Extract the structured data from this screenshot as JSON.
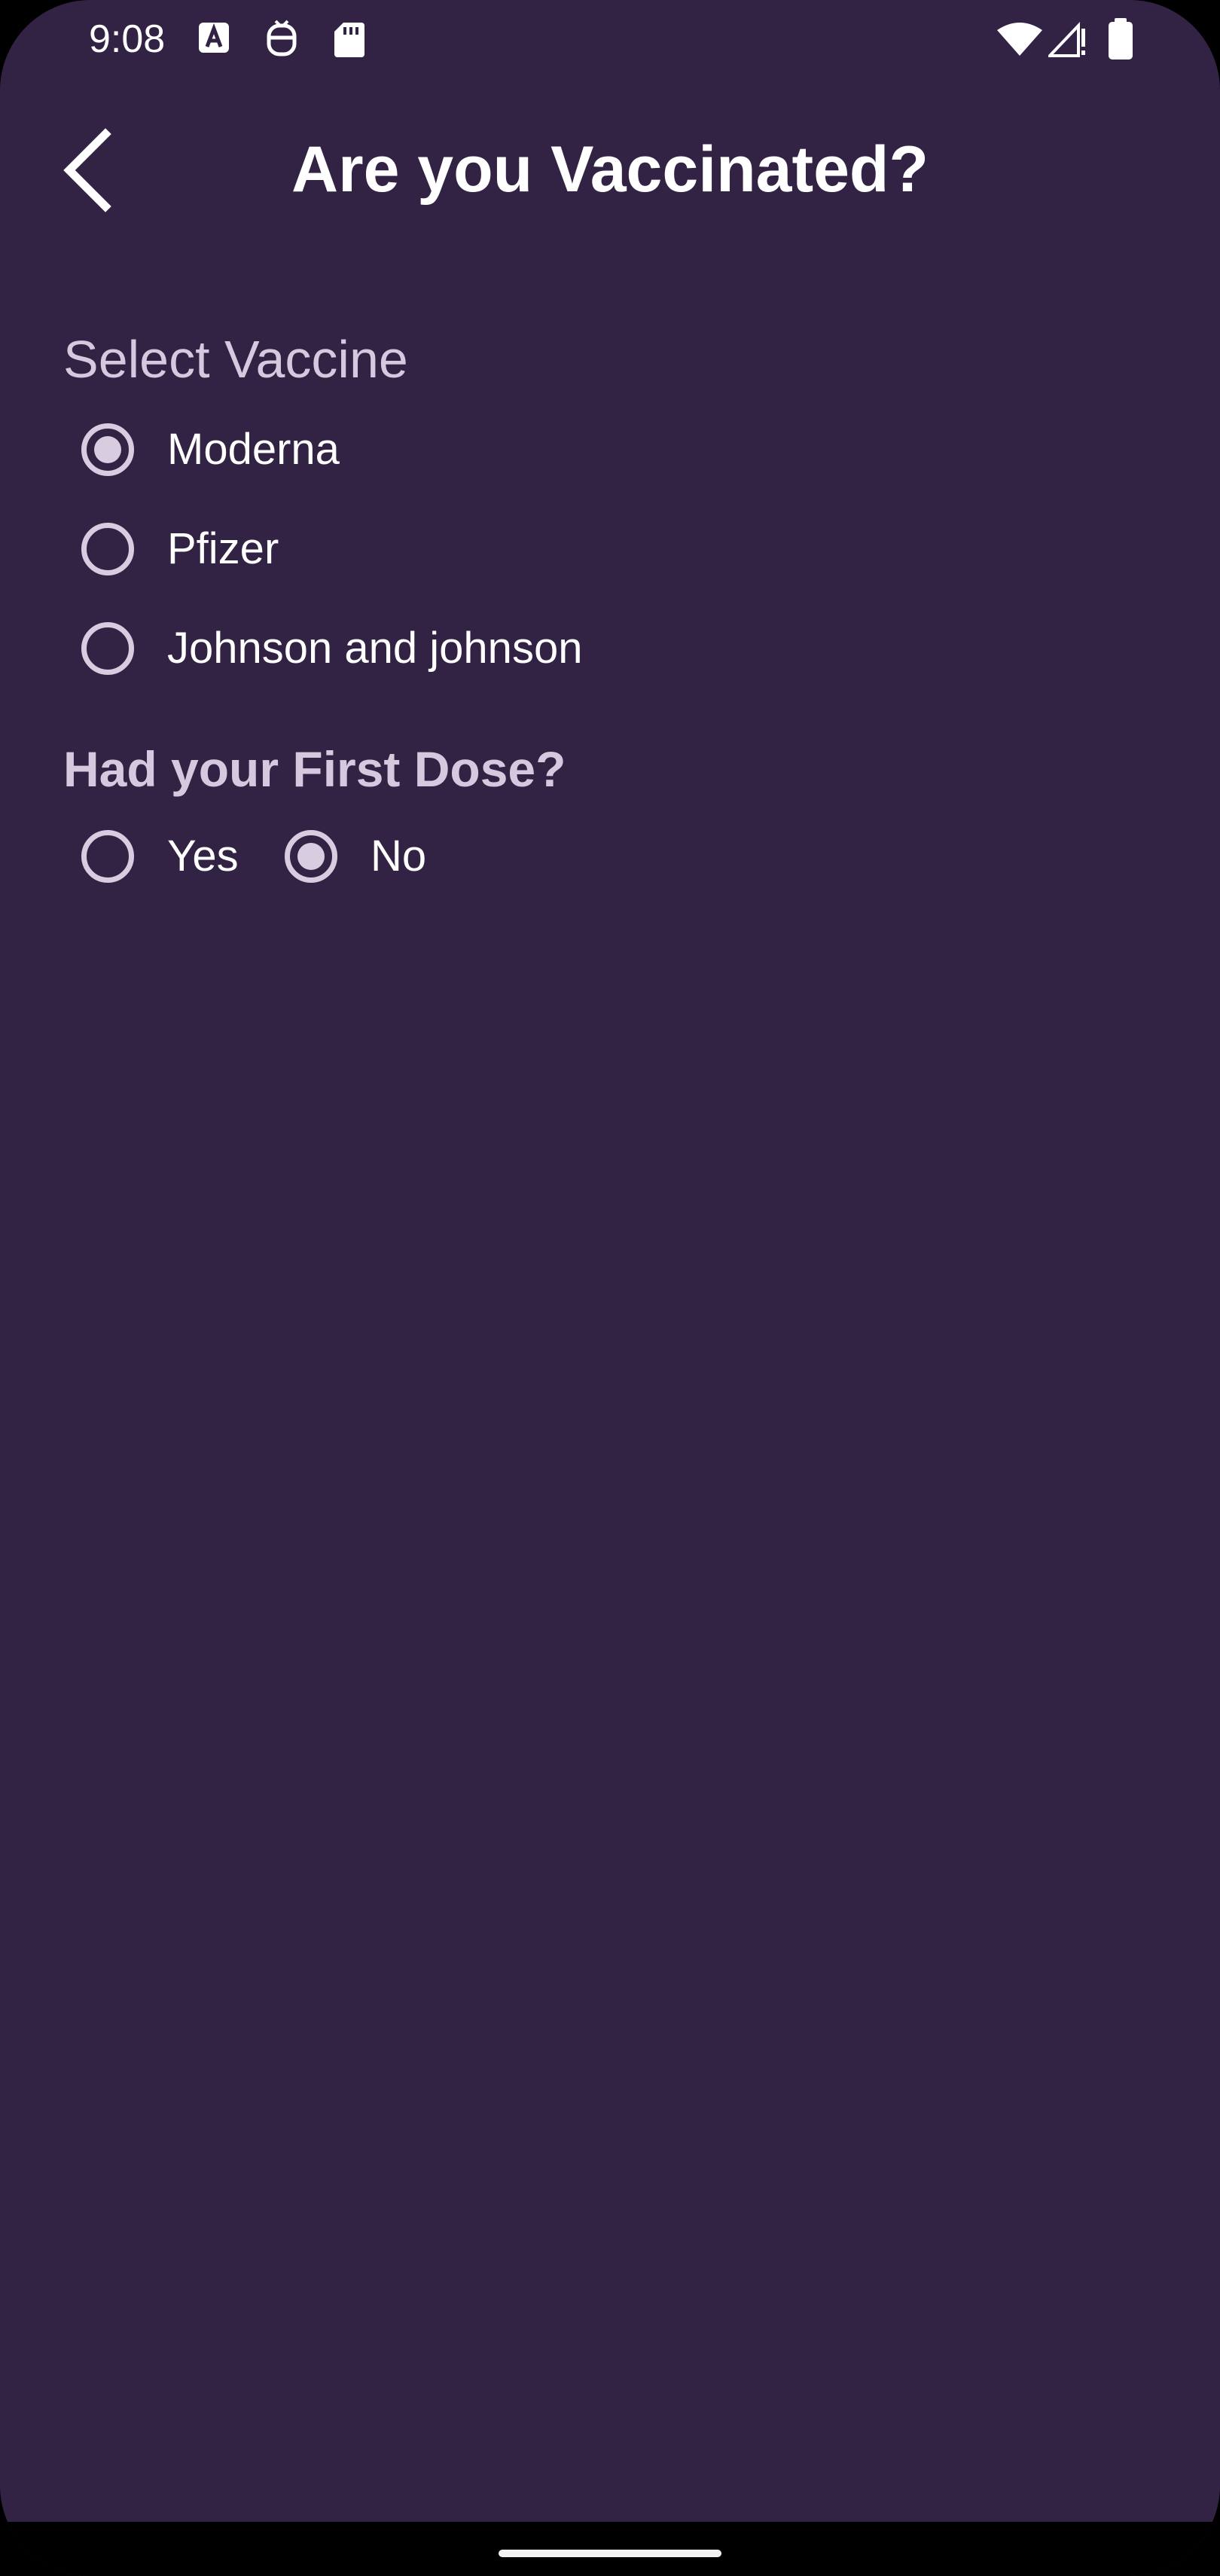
{
  "status_bar": {
    "time": "9:08",
    "left_icons": [
      "font-a-icon",
      "notification-face-icon",
      "sd-card-icon"
    ],
    "right_icons": [
      "wifi-icon",
      "signal-alert-icon",
      "battery-icon"
    ]
  },
  "header": {
    "title": "Are you Vaccinated?",
    "back_icon": "chevron-left-icon"
  },
  "vaccine_section": {
    "label": "Select Vaccine",
    "options": [
      {
        "label": "Moderna",
        "selected": true
      },
      {
        "label": "Pfizer",
        "selected": false
      },
      {
        "label": "Johnson and johnson",
        "selected": false
      }
    ]
  },
  "dose_section": {
    "label": "Had your First Dose?",
    "options": [
      {
        "label": "Yes",
        "selected": false
      },
      {
        "label": "No",
        "selected": true
      }
    ]
  },
  "colors": {
    "background": "#322244",
    "radio": "#d8cde0",
    "label": "#d6c9df",
    "text": "#ffffff"
  }
}
